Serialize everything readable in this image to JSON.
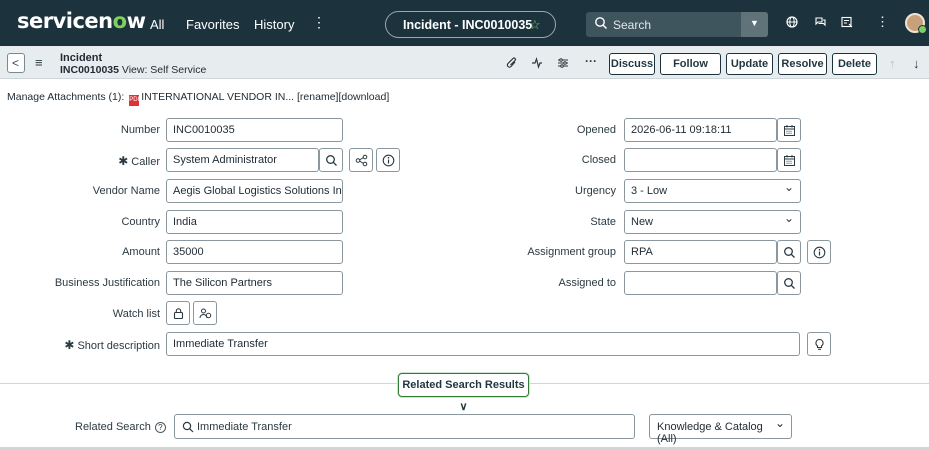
{
  "topnav": {
    "logo_prefix": "servicen",
    "logo_o": "o",
    "logo_suffix": "w",
    "all": "All",
    "favorites": "Favorites",
    "history": "History",
    "more": "⋮",
    "record_title": "Incident - INC0010035",
    "search_placeholder": "Search",
    "brand_color": "#1c333e",
    "accent_color": "#7ed05f"
  },
  "header": {
    "back": "<",
    "menu": "≡",
    "title": "Incident",
    "number": "INC0010035",
    "view": "View: Self Service",
    "buttons": {
      "discuss": "Discuss",
      "follow": "Follow",
      "update": "Update",
      "resolve": "Resolve",
      "delete": "Delete"
    },
    "icons": [
      "paperclip-icon",
      "activity-icon",
      "settings-sliders-icon",
      "more-icon",
      "arrow-up-icon",
      "arrow-down-icon"
    ]
  },
  "attachments": {
    "label": "Manage Attachments (1):",
    "file": "INTERNATIONAL VENDOR IN...",
    "rename": "[rename]",
    "download": "[download]"
  },
  "form": {
    "number": {
      "label": "Number",
      "value": "INC0010035"
    },
    "caller": {
      "label": "Caller",
      "value": "System Administrator",
      "required": "✱"
    },
    "vendor_name": {
      "label": "Vendor Name",
      "value": "Aegis Global Logistics Solutions Inc."
    },
    "country": {
      "label": "Country",
      "value": "India"
    },
    "amount": {
      "label": "Amount",
      "value": "35000"
    },
    "business_justification": {
      "label": "Business Justification",
      "value": "The Silicon Partners"
    },
    "watch_list": {
      "label": "Watch list"
    },
    "short_description": {
      "label": "Short description",
      "value": "Immediate Transfer",
      "required": "✱"
    },
    "opened": {
      "label": "Opened",
      "value": "2026-06-11 09:18:11"
    },
    "closed": {
      "label": "Closed",
      "value": ""
    },
    "urgency": {
      "label": "Urgency",
      "value": "3 - Low"
    },
    "state": {
      "label": "State",
      "value": "New"
    },
    "assignment_group": {
      "label": "Assignment group",
      "value": "RPA"
    },
    "assigned_to": {
      "label": "Assigned to",
      "value": ""
    }
  },
  "related": {
    "button": "Related Search Results ∨",
    "label": "Related Search",
    "help": "?",
    "search_value": "Immediate Transfer",
    "scope": "Knowledge & Catalog (All)"
  }
}
